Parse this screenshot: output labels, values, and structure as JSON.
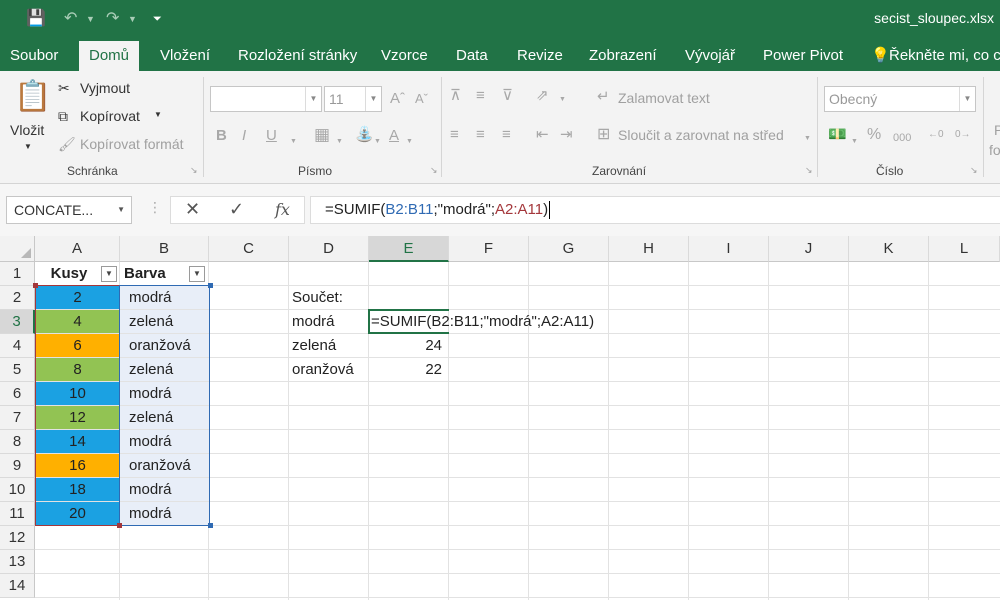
{
  "window": {
    "filename": "secist_sloupec.xlsx"
  },
  "tabs": [
    {
      "label": "Soubor",
      "active": false
    },
    {
      "label": "Domů",
      "active": true
    },
    {
      "label": "Vložení",
      "active": false
    },
    {
      "label": "Rozložení stránky",
      "active": false
    },
    {
      "label": "Vzorce",
      "active": false
    },
    {
      "label": "Data",
      "active": false
    },
    {
      "label": "Revize",
      "active": false
    },
    {
      "label": "Zobrazení",
      "active": false
    },
    {
      "label": "Vývojář",
      "active": false
    },
    {
      "label": "Power Pivot",
      "active": false
    }
  ],
  "tell_me": "Řekněte mi, co c",
  "ribbon": {
    "clipboard": {
      "paste": "Vložit",
      "cut": "Vyjmout",
      "copy": "Kopírovat",
      "format_painter": "Kopírovat formát",
      "label": "Schránka"
    },
    "font": {
      "size": "11",
      "label": "Písmo"
    },
    "alignment": {
      "wrap": "Zalamovat text",
      "merge": "Sloučit a zarovnat na střed",
      "label": "Zarovnání"
    },
    "number": {
      "format": "Obecný",
      "label": "Číslo"
    },
    "styles_cut": "P",
    "styles_cut2": "fo"
  },
  "formula_bar": {
    "name_box": "CONCATE...",
    "formula_prefix": "=SUMIF(",
    "ref1": "B2:B11",
    "mid": ";\"modrá\";",
    "ref2": "A2:A11",
    "suffix": ")"
  },
  "columns": [
    "A",
    "B",
    "C",
    "D",
    "E",
    "F",
    "G",
    "H",
    "I",
    "J",
    "K",
    "L"
  ],
  "rows": [
    "1",
    "2",
    "3",
    "4",
    "5",
    "6",
    "7",
    "8",
    "9",
    "10",
    "11",
    "12",
    "13",
    "14"
  ],
  "table": {
    "headers": [
      "Kusy",
      "Barva"
    ],
    "rows": [
      {
        "kusy": "2",
        "barva": "modrá",
        "color": "#1ba1e2"
      },
      {
        "kusy": "4",
        "barva": "zelená",
        "color": "#92c353"
      },
      {
        "kusy": "6",
        "barva": "oranžová",
        "color": "#ffb000"
      },
      {
        "kusy": "8",
        "barva": "zelená",
        "color": "#92c353"
      },
      {
        "kusy": "10",
        "barva": "modrá",
        "color": "#1ba1e2"
      },
      {
        "kusy": "12",
        "barva": "zelená",
        "color": "#92c353"
      },
      {
        "kusy": "14",
        "barva": "modrá",
        "color": "#1ba1e2"
      },
      {
        "kusy": "16",
        "barva": "oranžová",
        "color": "#ffb000"
      },
      {
        "kusy": "18",
        "barva": "modrá",
        "color": "#1ba1e2"
      },
      {
        "kusy": "20",
        "barva": "modrá",
        "color": "#1ba1e2"
      }
    ]
  },
  "summary": {
    "title": "Součet:",
    "rows": [
      {
        "label": "modrá",
        "value": "=SUMIF(B2:B11;\"modrá\";A2:A11)"
      },
      {
        "label": "zelená",
        "value": "24"
      },
      {
        "label": "oranžová",
        "value": "22"
      }
    ]
  },
  "colors": {
    "excel_green": "#217346",
    "ref_blue": "#2f6ab3",
    "ref_red": "#a4373b",
    "range_fill": "#e8eef8"
  }
}
